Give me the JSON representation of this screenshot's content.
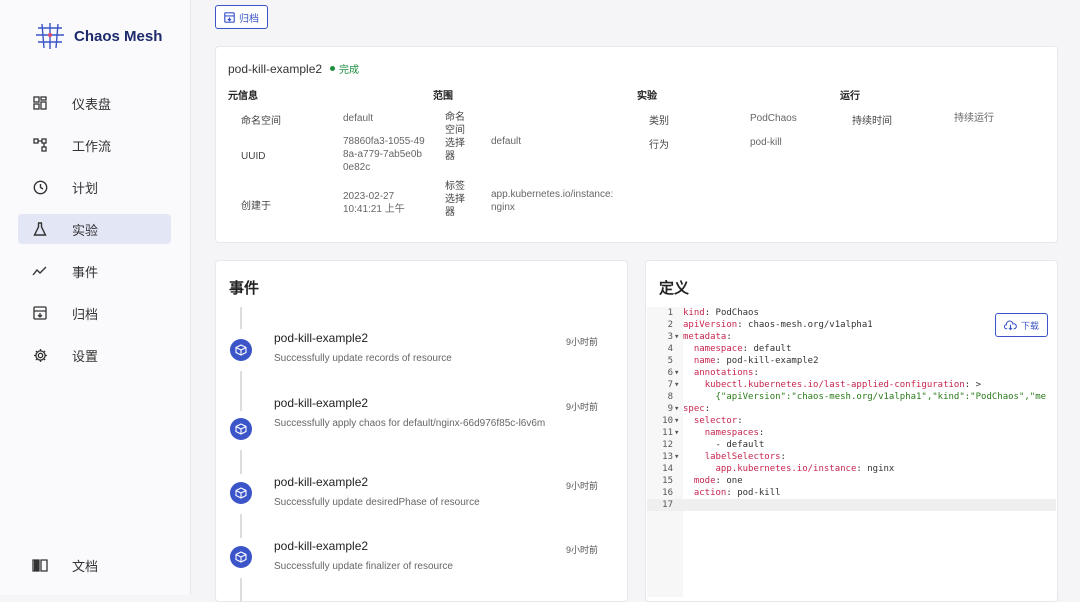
{
  "app": {
    "name": "Chaos Mesh"
  },
  "sidebar": {
    "items": [
      {
        "label": "仪表盘",
        "icon": "dashboard-icon"
      },
      {
        "label": "工作流",
        "icon": "workflow-icon"
      },
      {
        "label": "计划",
        "icon": "schedule-clock-icon"
      },
      {
        "label": "实验",
        "icon": "flask-icon",
        "active": true
      },
      {
        "label": "事件",
        "icon": "events-chart-icon"
      },
      {
        "label": "归档",
        "icon": "archive-icon"
      },
      {
        "label": "设置",
        "icon": "gear-icon"
      }
    ],
    "docs": {
      "label": "文档",
      "icon": "book-icon"
    }
  },
  "toolbar": {
    "archive_label": "归档"
  },
  "experiment": {
    "name": "pod-kill-example2",
    "status": "完成",
    "status_color": "#1e8e3e",
    "sections": {
      "meta": "元信息",
      "scope": "范围",
      "experiment": "实验",
      "run": "运行"
    },
    "meta": {
      "namespace_label": "命名空间",
      "namespace_value": "default",
      "uuid_label": "UUID",
      "uuid_value": "78860fa3-1055-498a-a779-7ab5e0b0e82c",
      "created_label": "创建于",
      "created_value": "2023-02-27 10:41:21 上午"
    },
    "scope": {
      "ns_selector_label": "命名空间选择器",
      "ns_selector_value": "default",
      "label_selector_label": "标签选择器",
      "label_selector_value": "app.kubernetes.io/instance: nginx"
    },
    "experiment_info": {
      "kind_label": "类别",
      "kind_value": "PodChaos",
      "action_label": "行为",
      "action_value": "pod-kill"
    },
    "run": {
      "duration_label": "持续时间",
      "duration_value": "持续运行"
    }
  },
  "events": {
    "title": "事件",
    "items": [
      {
        "title": "pod-kill-example2",
        "desc": "Successfully update records of resource",
        "time": "9小时前"
      },
      {
        "title": "pod-kill-example2",
        "desc": "Successfully apply chaos for default/nginx-66d976f85c-l6v6m",
        "time": "9小时前"
      },
      {
        "title": "pod-kill-example2",
        "desc": "Successfully update desiredPhase of resource",
        "time": "9小时前"
      },
      {
        "title": "pod-kill-example2",
        "desc": "Successfully update finalizer of resource",
        "time": "9小时前"
      }
    ]
  },
  "definition": {
    "title": "定义",
    "download_label": "下载",
    "lines": [
      {
        "n": "1",
        "fold": "",
        "indent": "",
        "key": "kind",
        "val": "PodChaos"
      },
      {
        "n": "2",
        "fold": "",
        "indent": "",
        "key": "apiVersion",
        "val": "chaos-mesh.org/v1alpha1"
      },
      {
        "n": "3",
        "fold": "▾",
        "indent": "",
        "key": "metadata",
        "val": ""
      },
      {
        "n": "4",
        "fold": "",
        "indent": "  ",
        "key": "namespace",
        "val": "default"
      },
      {
        "n": "5",
        "fold": "",
        "indent": "  ",
        "key": "name",
        "val": "pod-kill-example2"
      },
      {
        "n": "6",
        "fold": "▾",
        "indent": "  ",
        "key": "annotations",
        "val": ""
      },
      {
        "n": "7",
        "fold": "▾",
        "indent": "    ",
        "key": "kubectl.kubernetes.io/last-applied-configuration",
        "val": ">"
      },
      {
        "n": "8",
        "fold": "",
        "indent": "      ",
        "key": "",
        "val": "{\"apiVersion\":\"chaos-mesh.org/v1alpha1\",\"kind\":\"PodChaos\",\"me"
      },
      {
        "n": "9",
        "fold": "▾",
        "indent": "",
        "key": "spec",
        "val": ""
      },
      {
        "n": "10",
        "fold": "▾",
        "indent": "  ",
        "key": "selector",
        "val": ""
      },
      {
        "n": "11",
        "fold": "▾",
        "indent": "    ",
        "key": "namespaces",
        "val": ""
      },
      {
        "n": "12",
        "fold": "",
        "indent": "      ",
        "key": "",
        "val": "- default"
      },
      {
        "n": "13",
        "fold": "▾",
        "indent": "    ",
        "key": "labelSelectors",
        "val": ""
      },
      {
        "n": "14",
        "fold": "",
        "indent": "      ",
        "key": "app.kubernetes.io/instance",
        "val": "nginx"
      },
      {
        "n": "15",
        "fold": "",
        "indent": "  ",
        "key": "mode",
        "val": "one"
      },
      {
        "n": "16",
        "fold": "",
        "indent": "  ",
        "key": "action",
        "val": "pod-kill"
      },
      {
        "n": "17",
        "fold": "",
        "indent": "",
        "key": "",
        "val": ""
      }
    ]
  },
  "colors": {
    "accent": "#3b55c9",
    "success": "#1e8e3e"
  }
}
